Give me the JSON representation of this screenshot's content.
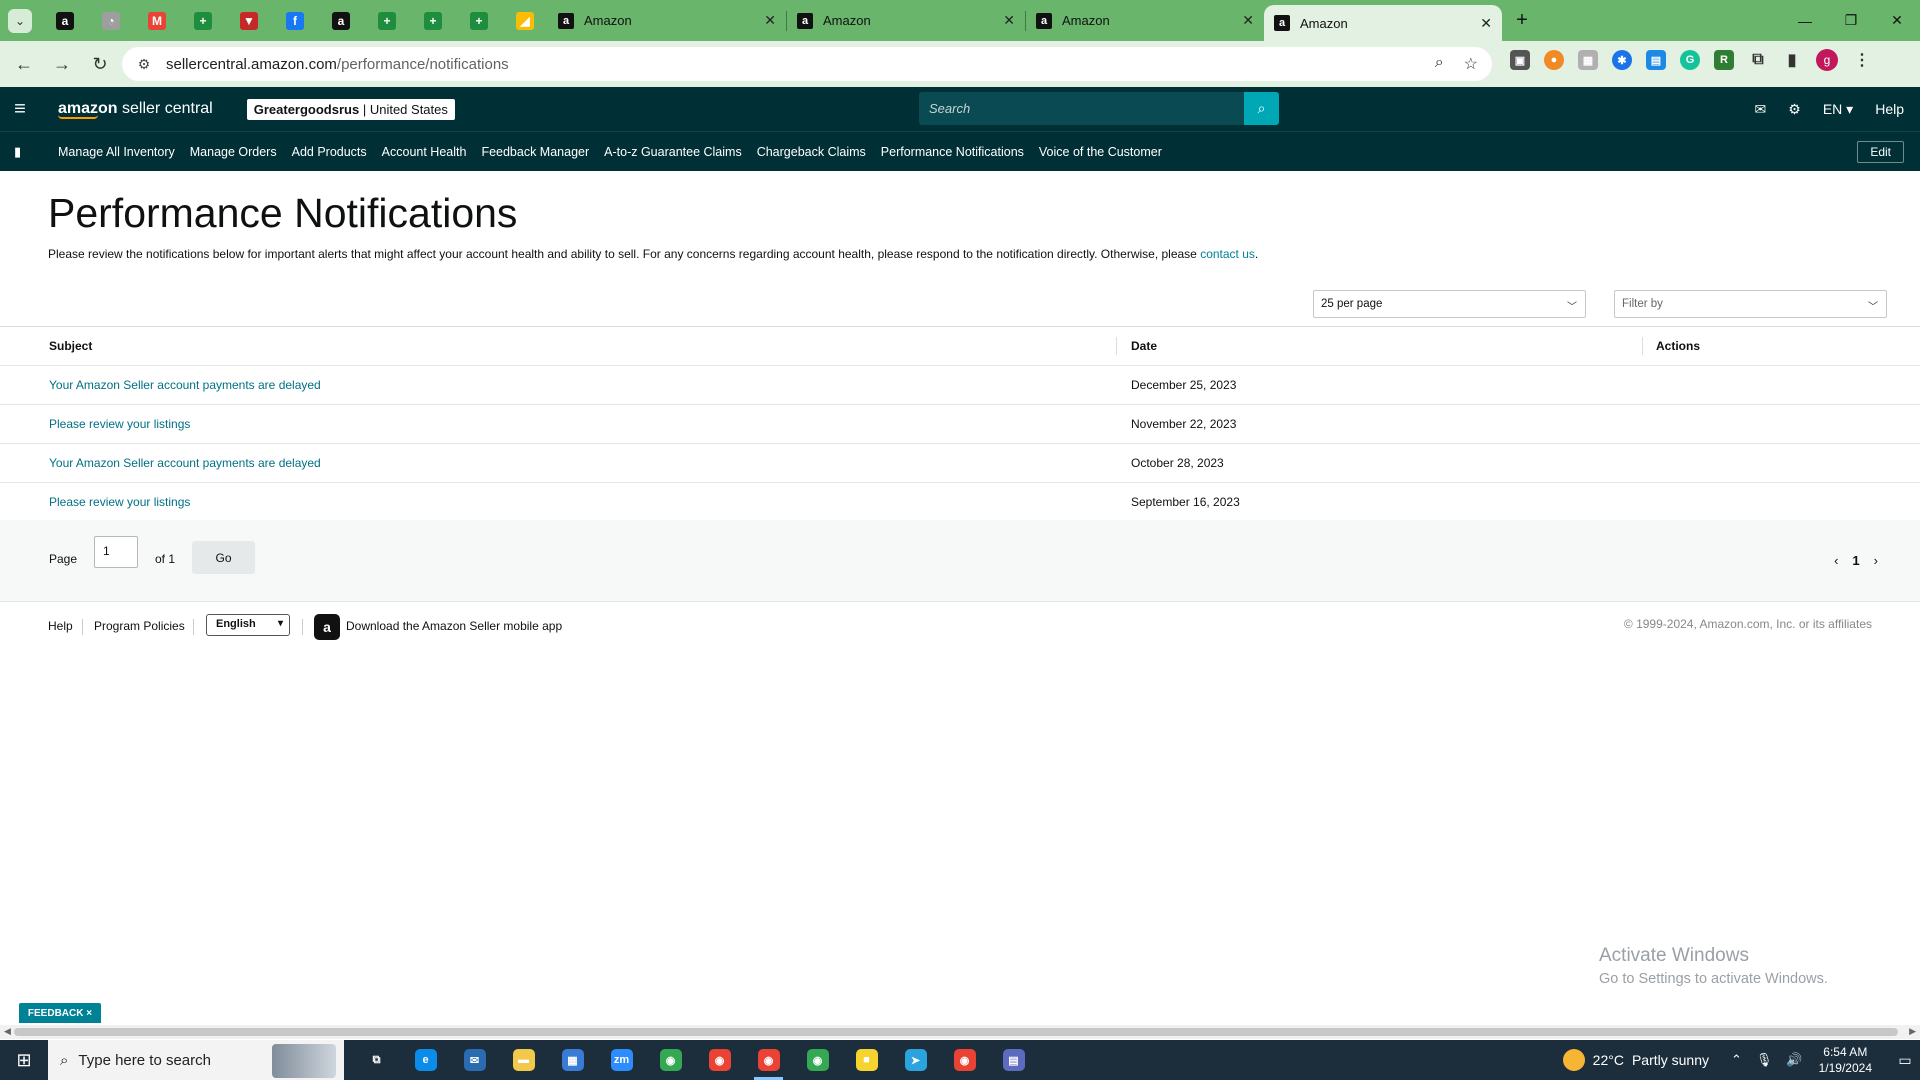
{
  "browser": {
    "pinned_tabs": [
      {
        "icon": "amazon-icon",
        "glyph": "a",
        "color": "#111111"
      },
      {
        "icon": "globe-icon",
        "glyph": "◔",
        "color": "#9e9e9e"
      },
      {
        "icon": "gmail-icon",
        "glyph": "M",
        "color": "#ea4335"
      },
      {
        "icon": "sheets-plus-icon",
        "glyph": "+",
        "color": "#1e8e3e"
      },
      {
        "icon": "shield-icon",
        "glyph": "▼",
        "color": "#c62828"
      },
      {
        "icon": "facebook-icon",
        "glyph": "f",
        "color": "#1877f2"
      },
      {
        "icon": "amazon-icon",
        "glyph": "a",
        "color": "#111111"
      },
      {
        "icon": "sheets-plus-icon",
        "glyph": "+",
        "color": "#1e8e3e"
      },
      {
        "icon": "sheets-plus-icon",
        "glyph": "+",
        "color": "#1e8e3e"
      },
      {
        "icon": "sheets-plus-icon",
        "glyph": "+",
        "color": "#1e8e3e"
      },
      {
        "icon": "google-ads-icon",
        "glyph": "◢",
        "color": "#fbbc04"
      }
    ],
    "tabs": [
      {
        "title": "Amazon",
        "active": false
      },
      {
        "title": "Amazon",
        "active": false
      },
      {
        "title": "Amazon",
        "active": false
      },
      {
        "title": "Amazon",
        "active": true
      }
    ],
    "url_host": "sellercentral.amazon.com",
    "url_path": "/performance/notifications",
    "profile_initial": "g"
  },
  "header": {
    "logo_bold": "amazon",
    "logo_rest": " seller central",
    "store_name": "Greatergoodsrus",
    "store_region": "United States",
    "search_placeholder": "Search",
    "language": "EN ▾",
    "help": "Help"
  },
  "nav": {
    "items": [
      "Manage All Inventory",
      "Manage Orders",
      "Add Products",
      "Account Health",
      "Feedback Manager",
      "A-to-z Guarantee Claims",
      "Chargeback Claims",
      "Performance Notifications",
      "Voice of the Customer"
    ],
    "edit": "Edit"
  },
  "main": {
    "title": "Performance Notifications",
    "intro": "Please review the notifications below for important alerts that might affect your account health and ability to sell. For any concerns regarding account health, please respond to the notification directly. Otherwise, please ",
    "contact_link": "contact us",
    "per_page": "25 per page",
    "filter_placeholder": "Filter by",
    "columns": {
      "subject": "Subject",
      "date": "Date",
      "actions": "Actions"
    },
    "rows": [
      {
        "subject": "Your Amazon Seller account payments are delayed",
        "date": "December 25, 2023"
      },
      {
        "subject": "Please review your listings",
        "date": "November 22, 2023"
      },
      {
        "subject": "Your Amazon Seller account payments are delayed",
        "date": "October 28, 2023"
      },
      {
        "subject": "Please review your listings",
        "date": "September 16, 2023"
      }
    ],
    "pager": {
      "page_label": "Page",
      "page_value": "1",
      "of_label": "of 1",
      "go": "Go",
      "current": "1"
    }
  },
  "footer": {
    "help": "Help",
    "policies": "Program Policies",
    "language": "English",
    "app_text": "Download the Amazon Seller mobile app",
    "copyright": "© 1999-2024, Amazon.com, Inc. or its affiliates"
  },
  "overlay": {
    "activate_title": "Activate Windows",
    "activate_sub": "Go to Settings to activate Windows.",
    "feedback": "FEEDBACK ×"
  },
  "taskbar": {
    "search_placeholder": "Type here to search",
    "apps": [
      {
        "icon": "task-view-icon",
        "glyph": "⧉",
        "color": "#1c2e3c"
      },
      {
        "icon": "edge-icon",
        "glyph": "e",
        "color": "#0c8ce9"
      },
      {
        "icon": "mail-icon",
        "glyph": "✉",
        "color": "#2b6cb0"
      },
      {
        "icon": "file-explorer-icon",
        "glyph": "▬",
        "color": "#f2c94c"
      },
      {
        "icon": "store-icon",
        "glyph": "▦",
        "color": "#3a7bd5"
      },
      {
        "icon": "zoom-icon",
        "glyph": "zm",
        "color": "#2d8cff"
      },
      {
        "icon": "chrome-icon",
        "glyph": "◉",
        "color": "#34a853"
      },
      {
        "icon": "chrome-icon",
        "glyph": "◉",
        "color": "#ea4335"
      },
      {
        "icon": "chrome-icon",
        "glyph": "◉",
        "color": "#ea4335"
      },
      {
        "icon": "chrome-icon",
        "glyph": "◉",
        "color": "#34a853"
      },
      {
        "icon": "sticky-notes-icon",
        "glyph": "■",
        "color": "#f7d330"
      },
      {
        "icon": "telegram-icon",
        "glyph": "➤",
        "color": "#2aa3de"
      },
      {
        "icon": "chrome-icon",
        "glyph": "◉",
        "color": "#ea4335"
      },
      {
        "icon": "calculator-icon",
        "glyph": "▤",
        "color": "#5c6bc0"
      }
    ],
    "active_index": 8,
    "temperature": "22°C",
    "weather": "Partly sunny",
    "time": "6:54 AM",
    "date": "1/19/2024"
  }
}
